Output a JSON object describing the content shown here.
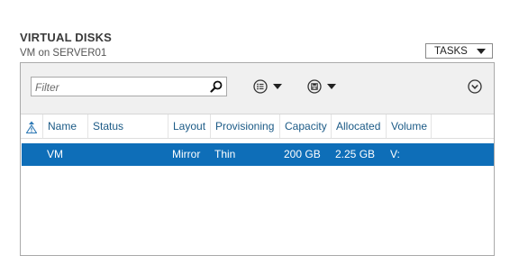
{
  "header": {
    "title": "VIRTUAL DISKS",
    "subtitle": "VM on SERVER01",
    "tasks_label": "TASKS"
  },
  "toolbar": {
    "filter_placeholder": "Filter",
    "icons": [
      "search-icon",
      "list-options-icon",
      "save-query-icon",
      "expand-icon"
    ]
  },
  "table": {
    "columns": [
      "Name",
      "Status",
      "Layout",
      "Provisioning",
      "Capacity",
      "Allocated",
      "Volume"
    ],
    "rows": [
      {
        "name": "VM",
        "status": "",
        "layout": "Mirror",
        "provisioning": "Thin",
        "capacity": "200 GB",
        "allocated": "2.25 GB",
        "volume": "V:",
        "selected": true
      }
    ]
  },
  "colors": {
    "selection": "#0e6eb8",
    "header_text": "#1b5a86",
    "toolbar_bg": "#f0f0f0"
  }
}
